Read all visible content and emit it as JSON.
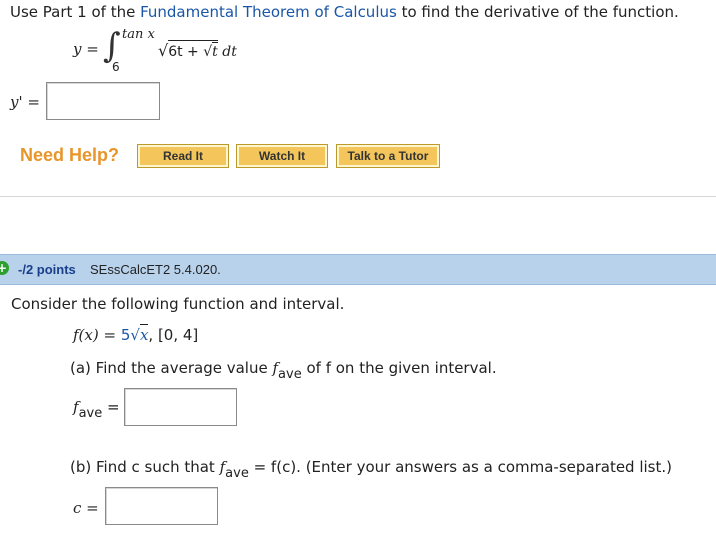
{
  "q1": {
    "instr_pre": "Use Part 1 of the ",
    "instr_link": "Fundamental Theorem of Calculus",
    "instr_post": " to find the derivative of the function.",
    "y_lhs": "y =",
    "upper_limit": "tan x",
    "lower_limit": "6",
    "integral_sign": "∫",
    "radical": "√",
    "integrand_a": "6t + ",
    "integrand_b": "t",
    "dt": "dt",
    "answer_label": "y' =",
    "answer_value": ""
  },
  "help": {
    "label": "Need Help?",
    "buttons": [
      "Read It",
      "Watch It",
      "Talk to a Tutor"
    ]
  },
  "q2": {
    "points": "-/2 points",
    "code": "SEssCalcET2 5.4.020.",
    "intro": "Consider the following function and interval.",
    "func_lhs": "f(x) = ",
    "func_coef": "5",
    "func_var": "x",
    "interval": ",  [0, 4]",
    "part_a_pre": "(a) Find the average value ",
    "f_symbol": "f",
    "ave_sub": "ave",
    "part_a_post": " of f on the given interval.",
    "fave_label_eq": "=",
    "fave_value": "",
    "part_b_pre": "(b) Find c such that ",
    "part_b_post": " = f(c). (Enter your answers as a comma-separated list.)",
    "c_label": "c =",
    "c_value": ""
  },
  "colors": {
    "link": "#1a56a8",
    "need_help": "#e8952a",
    "button_bg": "#f3c55a",
    "points_color": "#1a3f8a",
    "question_bar": "#b8d2ec",
    "plus_icon": "#2e9e2e"
  }
}
